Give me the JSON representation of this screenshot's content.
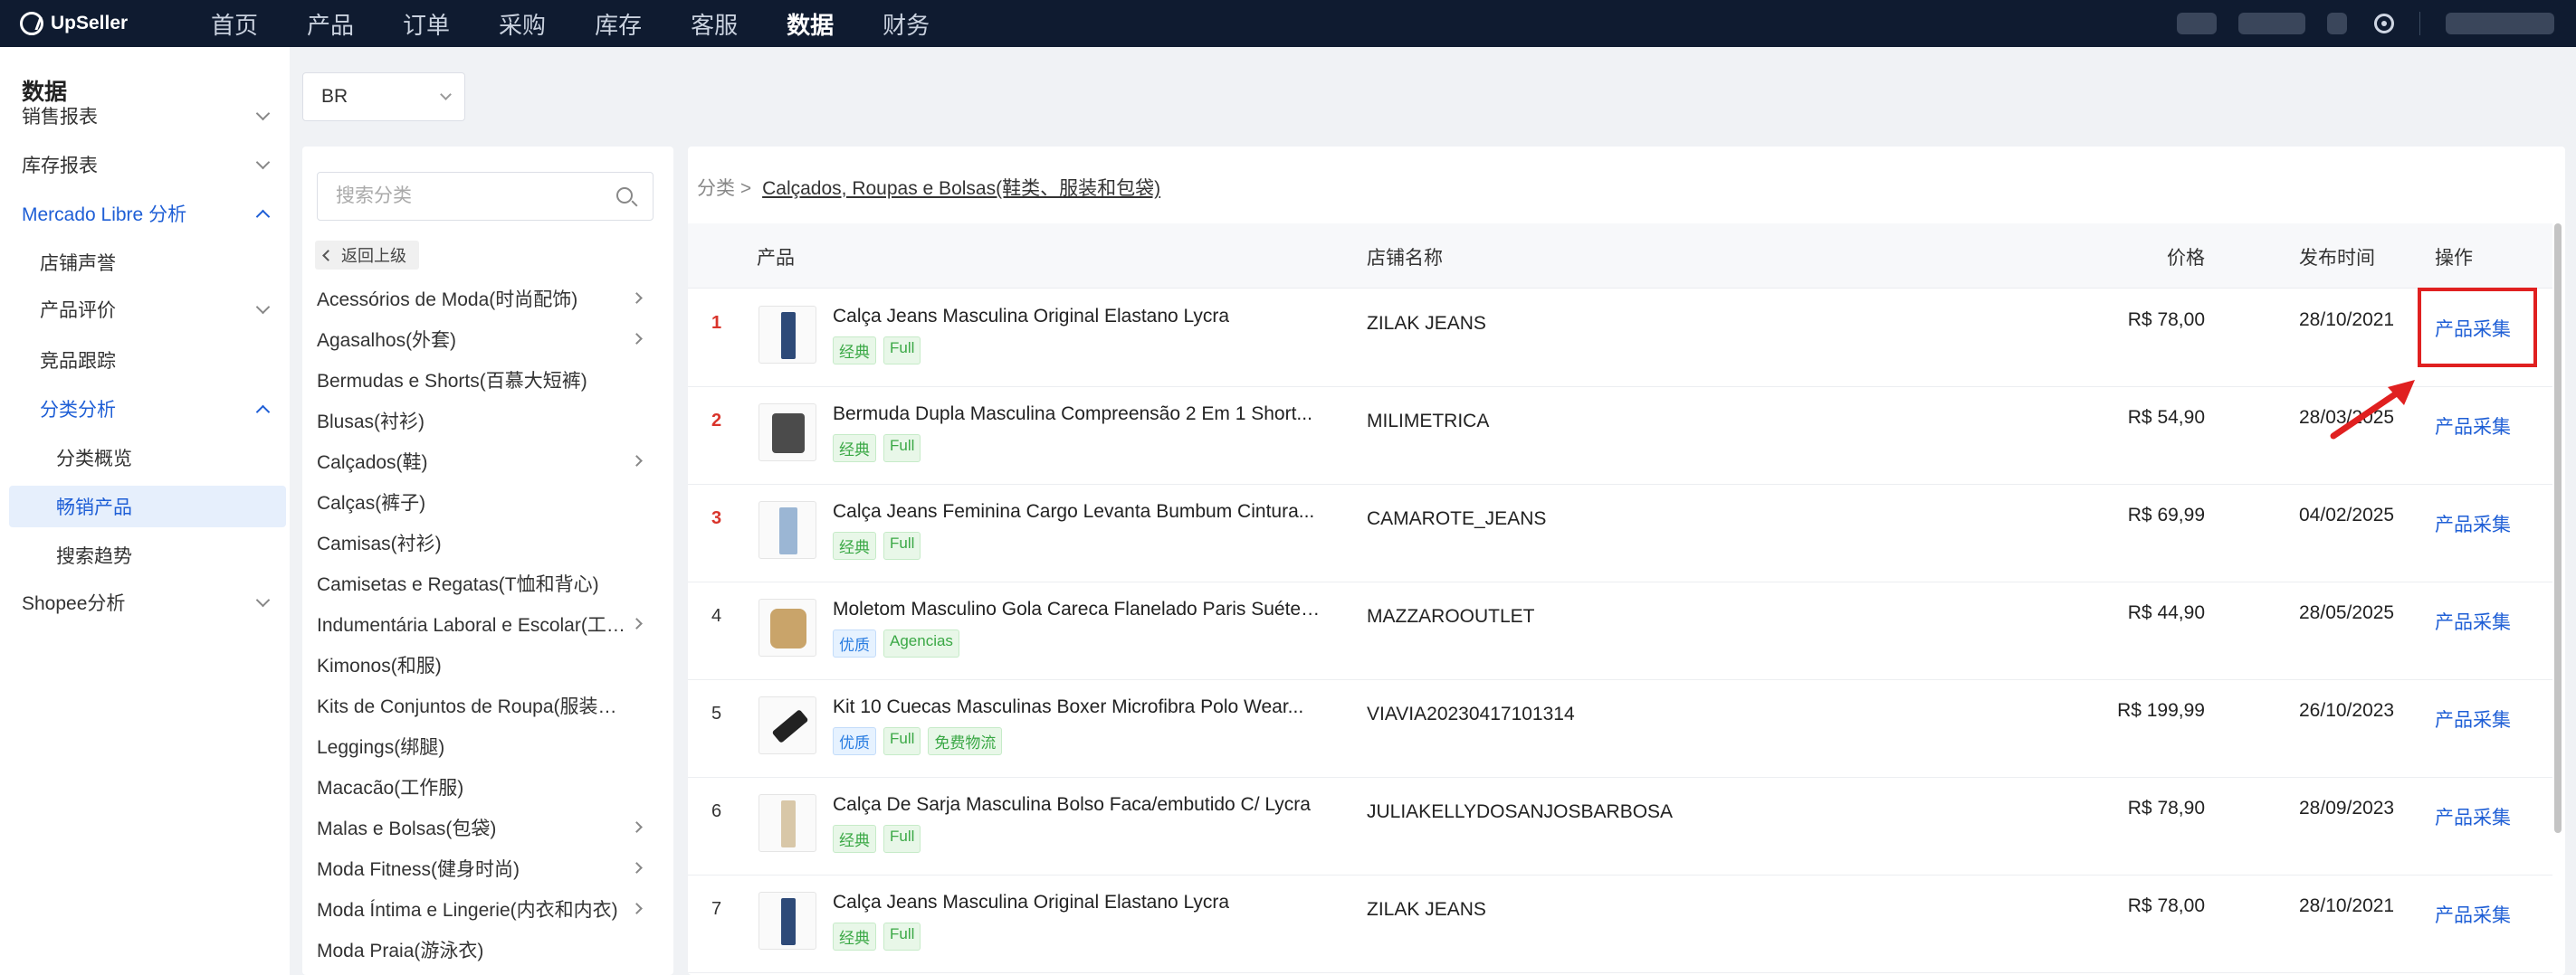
{
  "app": {
    "logo_text": "UpSeller",
    "nav": [
      "首页",
      "产品",
      "订单",
      "采购",
      "库存",
      "客服",
      "数据",
      "财务"
    ],
    "active_nav_index": 6
  },
  "sidebar": {
    "title": "数据",
    "items": [
      {
        "label": "销售报表",
        "level": 0,
        "chevron": "down"
      },
      {
        "label": "库存报表",
        "level": 0,
        "chevron": "down"
      },
      {
        "label": "Mercado Libre 分析",
        "level": 0,
        "chevron": "up",
        "expanded": true
      },
      {
        "label": "店铺声誉",
        "level": 1
      },
      {
        "label": "产品评价",
        "level": 1,
        "chevron": "down"
      },
      {
        "label": "竞品跟踪",
        "level": 1
      },
      {
        "label": "分类分析",
        "level": 1,
        "chevron": "up",
        "expanded": true
      },
      {
        "label": "分类概览",
        "level": 2
      },
      {
        "label": "畅销产品",
        "level": 2,
        "selected": true
      },
      {
        "label": "搜索趋势",
        "level": 2
      },
      {
        "label": "Shopee分析",
        "level": 0,
        "chevron": "down"
      }
    ]
  },
  "country_select": {
    "value": "BR"
  },
  "category_panel": {
    "search_placeholder": "搜索分类",
    "back_label": "返回上级",
    "items": [
      {
        "label": "Acessórios de Moda(时尚配饰)",
        "has_children": true
      },
      {
        "label": "Agasalhos(外套)",
        "has_children": true
      },
      {
        "label": "Bermudas e Shorts(百慕大短裤)",
        "has_children": false
      },
      {
        "label": "Blusas(衬衫)",
        "has_children": false
      },
      {
        "label": "Calçados(鞋)",
        "has_children": true
      },
      {
        "label": "Calças(裤子)",
        "has_children": false
      },
      {
        "label": "Camisas(衬衫)",
        "has_children": false
      },
      {
        "label": "Camisetas e Regatas(T恤和背心)",
        "has_children": false
      },
      {
        "label": "Indumentária Laboral e Escolar(工作服和校服)",
        "has_children": true
      },
      {
        "label": "Kimonos(和服)",
        "has_children": false
      },
      {
        "label": "Kits de Conjuntos de Roupa(服装套装)",
        "has_children": false
      },
      {
        "label": "Leggings(绑腿)",
        "has_children": false
      },
      {
        "label": "Macacão(工作服)",
        "has_children": false
      },
      {
        "label": "Malas e Bolsas(包袋)",
        "has_children": true
      },
      {
        "label": "Moda Fitness(健身时尚)",
        "has_children": true
      },
      {
        "label": "Moda Íntima e Lingerie(内衣和内衣)",
        "has_children": true
      },
      {
        "label": "Moda Praia(游泳衣)",
        "has_children": false
      }
    ]
  },
  "breadcrumb": {
    "prefix": "分类 >",
    "current": "Calçados, Roupas e Bolsas(鞋类、服装和包袋)"
  },
  "table": {
    "headers": {
      "product": "产品",
      "shop": "店铺名称",
      "price": "价格",
      "date": "发布时间",
      "action": "操作"
    },
    "rows": [
      {
        "rank": "1",
        "title": "Calça Jeans Masculina Original Elastano Lycra",
        "tags": [
          {
            "text": "经典",
            "color": "green"
          },
          {
            "text": "Full",
            "color": "green"
          }
        ],
        "shop": "ZILAK JEANS",
        "price": "R$ 78,00",
        "date": "28/10/2021",
        "action": "产品采集",
        "thumb": "jeans-dark"
      },
      {
        "rank": "2",
        "title": "Bermuda Dupla Masculina Compreensão 2 Em 1 Short...",
        "tags": [
          {
            "text": "经典",
            "color": "green"
          },
          {
            "text": "Full",
            "color": "green"
          }
        ],
        "shop": "MILIMETRICA",
        "price": "R$ 54,90",
        "date": "28/03/2025",
        "action": "产品采集",
        "thumb": "shorts"
      },
      {
        "rank": "3",
        "title": "Calça Jeans Feminina Cargo Levanta Bumbum Cintura...",
        "tags": [
          {
            "text": "经典",
            "color": "green"
          },
          {
            "text": "Full",
            "color": "green"
          }
        ],
        "shop": "CAMAROTE_JEANS",
        "price": "R$ 69,99",
        "date": "04/02/2025",
        "action": "产品采集",
        "thumb": "jeans-light"
      },
      {
        "rank": "4",
        "title": "Moletom Masculino Gola Careca Flanelado Paris Suéter...",
        "tags": [
          {
            "text": "优质",
            "color": "blue"
          },
          {
            "text": "Agencias",
            "color": "green"
          }
        ],
        "shop": "MAZZAROOUTLET",
        "price": "R$ 44,90",
        "date": "28/05/2025",
        "action": "产品采集",
        "thumb": "sweater"
      },
      {
        "rank": "5",
        "title": "Kit 10 Cuecas Masculinas Boxer Microfibra Polo Wear...",
        "tags": [
          {
            "text": "优质",
            "color": "blue"
          },
          {
            "text": "Full",
            "color": "green"
          },
          {
            "text": "免费物流",
            "color": "green"
          }
        ],
        "shop": "VIAVIA20230417101314",
        "price": "R$ 199,99",
        "date": "26/10/2023",
        "action": "产品采集",
        "thumb": "boxer"
      },
      {
        "rank": "6",
        "title": "Calça De Sarja Masculina Bolso Faca/embutido C/ Lycra",
        "tags": [
          {
            "text": "经典",
            "color": "green"
          },
          {
            "text": "Full",
            "color": "green"
          }
        ],
        "shop": "JULIAKELLYDOSANJOSBARBOSA",
        "price": "R$ 78,90",
        "date": "28/09/2023",
        "action": "产品采集",
        "thumb": "khaki"
      },
      {
        "rank": "7",
        "title": "Calça Jeans Masculina Original Elastano Lycra",
        "tags": [
          {
            "text": "经典",
            "color": "green"
          },
          {
            "text": "Full",
            "color": "green"
          }
        ],
        "shop": "ZILAK JEANS",
        "price": "R$ 78,00",
        "date": "28/10/2021",
        "action": "产品采集",
        "thumb": "jeans-dark"
      }
    ]
  },
  "colors": {
    "topbar": "#0f1b30",
    "accent": "#1f5fd6",
    "rank_top": "#d9342b",
    "highlight": "#e02020"
  }
}
